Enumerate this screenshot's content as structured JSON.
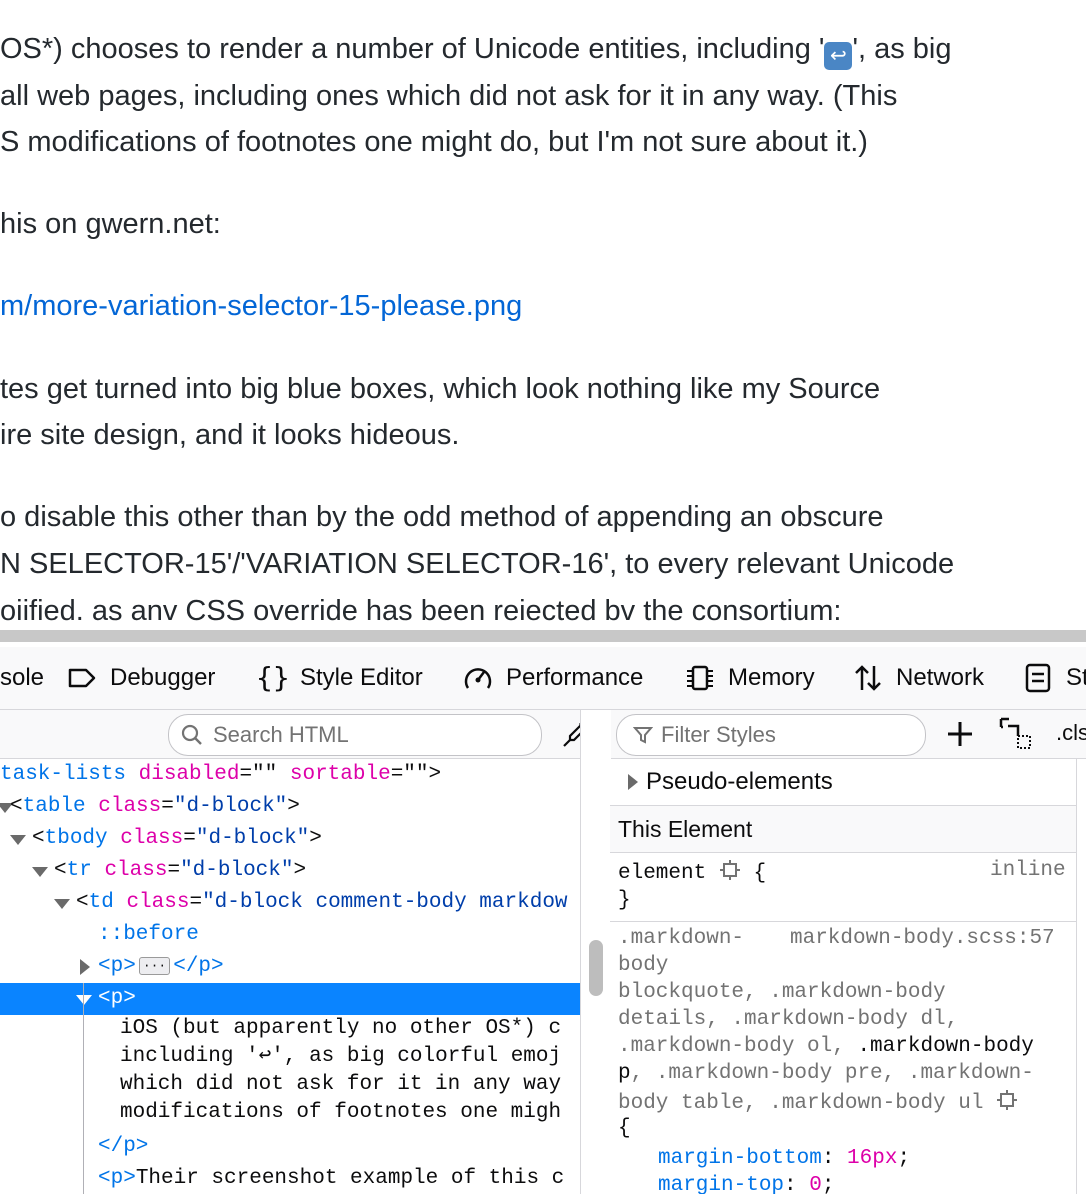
{
  "page": {
    "lines": [
      {
        "before": "OS*) chooses to render a number of Unicode entities, including '",
        "emoji": "↩",
        "after": "', as big"
      },
      {
        "text": "all web pages, including ones which did not ask for it in any way. (This"
      },
      {
        "text": "S modifications of footnotes one might do, but I'm not sure about it.)"
      },
      {
        "text": "his on gwern.net:"
      },
      {
        "link": "m/more-variation-selector-15-please.png"
      },
      {
        "text": "tes get turned into big blue boxes, which look nothing like my Source"
      },
      {
        "text": "ire site design, and it looks hideous."
      },
      {
        "text": "o disable this other than by the odd method of appending an obscure"
      },
      {
        "text": "N SELECTOR-15'/'VARIATION SELECTOR-16', to every relevant Unicode"
      },
      {
        "text": "oiified. as anv CSS override has been reiected bv the consortium:"
      }
    ]
  },
  "devtools": {
    "tabs": [
      {
        "label": "sole",
        "icon": "console-icon"
      },
      {
        "label": "Debugger",
        "icon": "debugger-icon"
      },
      {
        "label": "Style Editor",
        "icon": "style-editor-icon"
      },
      {
        "label": "Performance",
        "icon": "performance-icon"
      },
      {
        "label": "Memory",
        "icon": "memory-icon"
      },
      {
        "label": "Network",
        "icon": "network-icon"
      },
      {
        "label": "St",
        "icon": "storage-icon"
      }
    ],
    "search_html_placeholder": "Search HTML",
    "filter_styles_placeholder": "Filter Styles",
    "cls_label": ".cls",
    "markup": {
      "l1": {
        "a": "task-lists ",
        "b": "disabled",
        "c": "=\"\" ",
        "d": "sortable",
        "e": "=\"\">"
      },
      "l2": {
        "tag": "table",
        "attr": "class",
        "val": "\"d-block\""
      },
      "l3": {
        "tag": "tbody",
        "attr": "class",
        "val": "\"d-block\""
      },
      "l4": {
        "tag": "tr",
        "attr": "class",
        "val": "\"d-block\""
      },
      "l5": {
        "tag": "td",
        "attr": "class",
        "val": "\"d-block comment-body markdow"
      },
      "l6": "::before",
      "l7": {
        "open": "<p>",
        "ellipsis": "···",
        "close": "</p>"
      },
      "l8": "<p>",
      "text_lines": [
        "iOS (but apparently no other OS*) c",
        "including '↩', as big colorful emoj",
        "which did not ask for it in any way",
        "modifications of footnotes one migh"
      ],
      "close_p": "</p>",
      "l14": {
        "tag": "<p>",
        "text": "Their screenshot example of this c"
      }
    },
    "rules": {
      "pseudo": "Pseudo-elements",
      "this_element": "This Element",
      "element_sel": "element",
      "brace_open": "{",
      "brace_close": "}",
      "inline": "inline",
      "sel1": ".markdown-",
      "src": "markdown-body.scss:57",
      "sel2": "body",
      "sel3": "blockquote, .markdown-body",
      "sel4": "details, .markdown-body dl,",
      "sel5a": ".markdown-body ol, ",
      "sel5b": ".markdown-body",
      "sel6a": "p",
      "sel6b": ", .markdown-body pre, .markdown-",
      "sel7": "body table, .markdown-body ul",
      "decl1_prop": "margin-bottom",
      "decl1_val": "16px",
      "decl2_prop": "margin-top",
      "decl2_val": "0"
    }
  }
}
